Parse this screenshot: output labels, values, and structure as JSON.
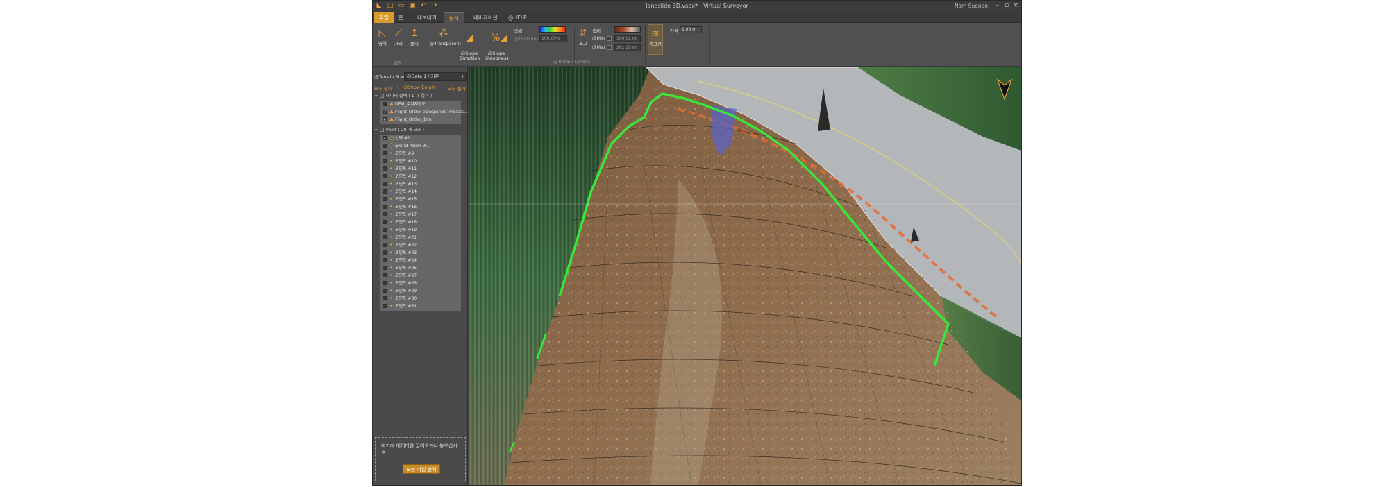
{
  "window": {
    "title": "landslide 3D.vspx* - Virtual Surveyor",
    "user": "Nam Suenen",
    "controls": [
      "–",
      "▫",
      "×"
    ]
  },
  "quick_access": [
    "new-icon",
    "open-icon",
    "save-icon",
    "save-as-icon",
    "undo-icon",
    "redo-icon"
  ],
  "menu_tabs": [
    {
      "label": "파일",
      "state": "file"
    },
    {
      "label": "홈",
      "state": ""
    },
    {
      "label": "내보내기",
      "state": ""
    },
    {
      "label": "분석",
      "state": "active"
    },
    {
      "label": "네비게이션",
      "state": ""
    },
    {
      "label": "@HELP",
      "state": ""
    }
  ],
  "ribbon": {
    "measure": {
      "buttons": [
        {
          "label": "영역",
          "icon": "area-measure-icon"
        },
        {
          "label": "거리",
          "icon": "distance-measure-icon"
        },
        {
          "label": "높이",
          "icon": "height-measure-icon"
        }
      ],
      "group_label": "측정"
    },
    "terrain": {
      "buttons": [
        {
          "label": "@Transparent",
          "icon": "transparent-icon"
        },
        {
          "label": "@Slope\nDirection",
          "icon": "slope-direction-icon"
        },
        {
          "label": "@Slope\nSteepness",
          "icon": "slope-steepness-icon"
        }
      ],
      "color_label": "색채",
      "threshold_label": "@Threshold",
      "threshold_value": "100.00%",
      "group_label": "@Terrain Lenses"
    },
    "elevation": {
      "button": {
        "label": "표고",
        "icon": "elevation-icon"
      },
      "color_label": "색채",
      "min_label": "@Min",
      "max_label": "@Max",
      "min_value": "190.92 m",
      "max_value": "262.25 m"
    },
    "contour": {
      "button": {
        "label": "등고선",
        "icon": "contour-icon"
      },
      "interval_label": "간격",
      "interval_value": "1.00 m"
    }
  },
  "panel": {
    "state_label": "@Terrain State",
    "state_value": "@Date 1 / 기준",
    "links": [
      "모두 펼치",
      "@Show Empty",
      "모두 접기"
    ],
    "groups": [
      {
        "label": "데이터 컬렉 ( 1 개 결과 )",
        "items": [
          {
            "label": "DEM_수치지형도",
            "checked": false,
            "icon": "terrain-layer-icon"
          },
          {
            "label": "Flight_Ortho_transparent_mosaic...",
            "checked": true,
            "icon": "terrain-layer-icon"
          },
          {
            "label": "Flight_Ortho_dsm",
            "checked": true,
            "icon": "terrain-layer-icon"
          }
        ]
      },
      {
        "label": "Point ( 29 개 요소 )",
        "items": [
          {
            "label": "선택 #1",
            "checked": true,
            "icon": "selection-icon"
          },
          {
            "label": "@Grid Points #1",
            "checked": false,
            "icon": "grid-points-icon"
          },
          {
            "label": "포인트 #9",
            "checked": false,
            "icon": "point-icon"
          },
          {
            "label": "포인트 #10",
            "checked": false,
            "icon": "point-icon"
          },
          {
            "label": "포인트 #11",
            "checked": false,
            "icon": "point-icon"
          },
          {
            "label": "포인트 #12",
            "checked": false,
            "icon": "point-icon"
          },
          {
            "label": "포인트 #13",
            "checked": false,
            "icon": "point-icon"
          },
          {
            "label": "포인트 #14",
            "checked": false,
            "icon": "point-icon"
          },
          {
            "label": "포인트 #15",
            "checked": false,
            "icon": "point-icon"
          },
          {
            "label": "포인트 #16",
            "checked": false,
            "icon": "point-icon"
          },
          {
            "label": "포인트 #17",
            "checked": false,
            "icon": "point-icon"
          },
          {
            "label": "포인트 #18",
            "checked": false,
            "icon": "point-icon"
          },
          {
            "label": "포인트 #19",
            "checked": false,
            "icon": "point-icon"
          },
          {
            "label": "포인트 #21",
            "checked": false,
            "icon": "point-icon"
          },
          {
            "label": "포인트 #22",
            "checked": false,
            "icon": "point-icon"
          },
          {
            "label": "포인트 #23",
            "checked": false,
            "icon": "point-icon"
          },
          {
            "label": "포인트 #24",
            "checked": false,
            "icon": "point-icon"
          },
          {
            "label": "포인트 #25",
            "checked": false,
            "icon": "point-icon"
          },
          {
            "label": "포인트 #27",
            "checked": false,
            "icon": "point-icon"
          },
          {
            "label": "포인트 #28",
            "checked": false,
            "icon": "point-icon"
          },
          {
            "label": "포인트 #29",
            "checked": false,
            "icon": "point-icon"
          },
          {
            "label": "포인트 #30",
            "checked": false,
            "icon": "point-icon"
          },
          {
            "label": "포인트 #31",
            "checked": false,
            "icon": "point-icon"
          }
        ]
      }
    ],
    "drop_text": "여기에 데이터를 끌어오거나 놓으십시오.",
    "drop_button": "또는 파일 선택"
  },
  "viewport": {
    "description_icon": "compass-north-icon",
    "colors": {
      "accent": "#e9a23b",
      "boundary": "#39e639",
      "ground": "#8a6a4a",
      "road": "#b9bcbf"
    }
  }
}
